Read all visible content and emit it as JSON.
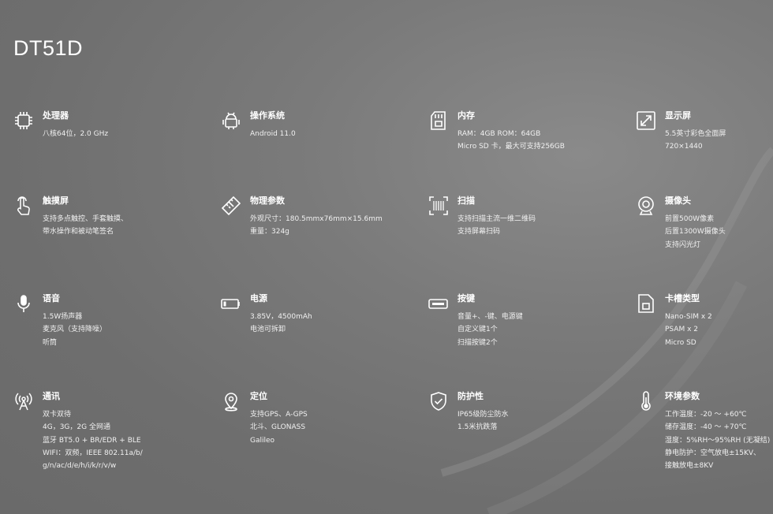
{
  "title": "DT51D",
  "specs": [
    {
      "name": "处理器",
      "icon": "cpu-icon",
      "lines": [
        "八核64位，2.0 GHz"
      ]
    },
    {
      "name": "操作系统",
      "icon": "android-icon",
      "lines": [
        "Android 11.0"
      ]
    },
    {
      "name": "内存",
      "icon": "sd-card-icon",
      "lines": [
        "RAM：4GB ROM：64GB",
        "Micro SD 卡，最大可支持256GB"
      ]
    },
    {
      "name": "显示屏",
      "icon": "display-expand-icon",
      "lines": [
        "5.5英寸彩色全面屏",
        "720×1440"
      ]
    },
    {
      "name": "触摸屏",
      "icon": "touch-hand-icon",
      "lines": [
        "支持多点触控、手套触摸、",
        "带水操作和被动笔签名"
      ]
    },
    {
      "name": "物理参数",
      "icon": "ruler-icon",
      "lines": [
        "外观尺寸：180.5mmx76mm×15.6mm",
        "重量：324g"
      ]
    },
    {
      "name": "扫描",
      "icon": "barcode-scan-icon",
      "lines": [
        "支持扫描主流一维二维码",
        "支持屏幕扫码"
      ]
    },
    {
      "name": "摄像头",
      "icon": "camera-icon",
      "lines": [
        "前置500W像素",
        "后置1300W摄像头",
        "支持闪光灯"
      ]
    },
    {
      "name": "语音",
      "icon": "microphone-icon",
      "lines": [
        "1.5W扬声器",
        "麦克风（支持降噪）",
        "听筒"
      ]
    },
    {
      "name": "电源",
      "icon": "battery-icon",
      "lines": [
        "3.85V，4500mAh",
        "电池可拆卸"
      ]
    },
    {
      "name": "按键",
      "icon": "key-button-icon",
      "lines": [
        "音量+、-键、电源键",
        "自定义键1个",
        "扫描按键2个"
      ]
    },
    {
      "name": "卡槽类型",
      "icon": "sim-card-icon",
      "lines": [
        "Nano-SIM x 2",
        "PSAM x 2",
        "Micro SD"
      ]
    },
    {
      "name": "通讯",
      "icon": "antenna-signal-icon",
      "lines": [
        "双卡双待",
        "4G，3G，2G 全网通",
        "蓝牙 BT5.0 + BR/EDR + BLE",
        "WIFI：双频，IEEE 802.11a/b/",
        "g/n/ac/d/e/h/i/k/r/v/w"
      ]
    },
    {
      "name": "定位",
      "icon": "location-pin-icon",
      "lines": [
        "支持GPS、A-GPS",
        "北斗、GLONASS",
        "Galileo"
      ]
    },
    {
      "name": "防护性",
      "icon": "shield-check-icon",
      "lines": [
        "IP65级防尘防水",
        "1.5米抗跌落"
      ]
    },
    {
      "name": "环境参数",
      "icon": "thermometer-icon",
      "lines": [
        "工作温度：-20 ～ +60℃",
        "储存温度：-40 ～ +70℃",
        "湿度：5%RH～95%RH (无凝结)",
        "静电防护：空气放电±15KV、",
        "接触放电±8KV"
      ]
    }
  ]
}
